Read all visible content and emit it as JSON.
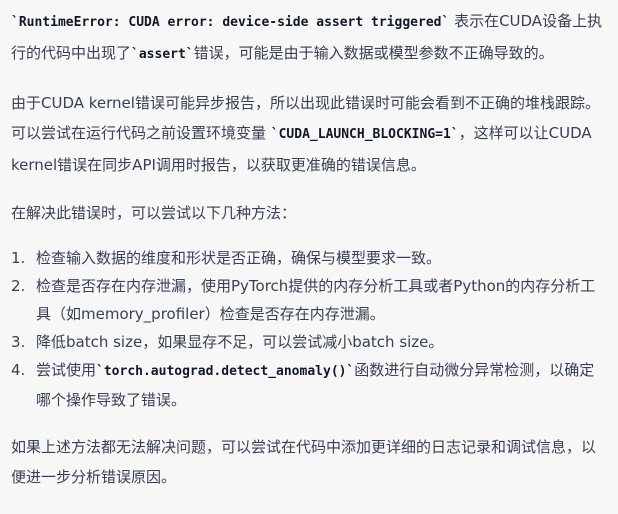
{
  "paragraphs": {
    "p1": {
      "code": "`RuntimeError: CUDA error: device-side assert triggered`",
      "text1": " 表示在CUDA设备上执行的代码中出现了",
      "code2": "`assert`",
      "text2": "错误，可能是由于输入数据或模型参数不正确导致的。"
    },
    "p2": {
      "text1": "由于CUDA kernel错误可能异步报告，所以出现此错误时可能会看到不正确的堆栈跟踪。可以尝试在运行代码之前设置环境变量 ",
      "code": "`CUDA_LAUNCH_BLOCKING=1`",
      "text2": "，这样可以让CUDA kernel错误在同步API调用时报告，以获取更准确的错误信息。"
    },
    "p3": {
      "text": "在解决此错误时，可以尝试以下几种方法："
    },
    "p4": {
      "text": "如果上述方法都无法解决问题，可以尝试在代码中添加更详细的日志记录和调试信息，以便进一步分析错误原因。"
    }
  },
  "list": [
    {
      "num": "1.",
      "text1": "检查输入数据的维度和形状是否正确，确保与模型要求一致。"
    },
    {
      "num": "2.",
      "text1": "检查是否存在内存泄漏，使用PyTorch提供的内存分析工具或者Python的内存分析工具（如memory_profiler）检查是否存在内存泄漏。"
    },
    {
      "num": "3.",
      "text1": "降低batch size，如果显存不足，可以尝试减小batch size。"
    },
    {
      "num": "4.",
      "text1": "尝试使用",
      "code": "`torch.autograd.detect_anomaly()`",
      "text2": "函数进行自动微分异常检测，以确定哪个操作导致了错误。"
    }
  ]
}
